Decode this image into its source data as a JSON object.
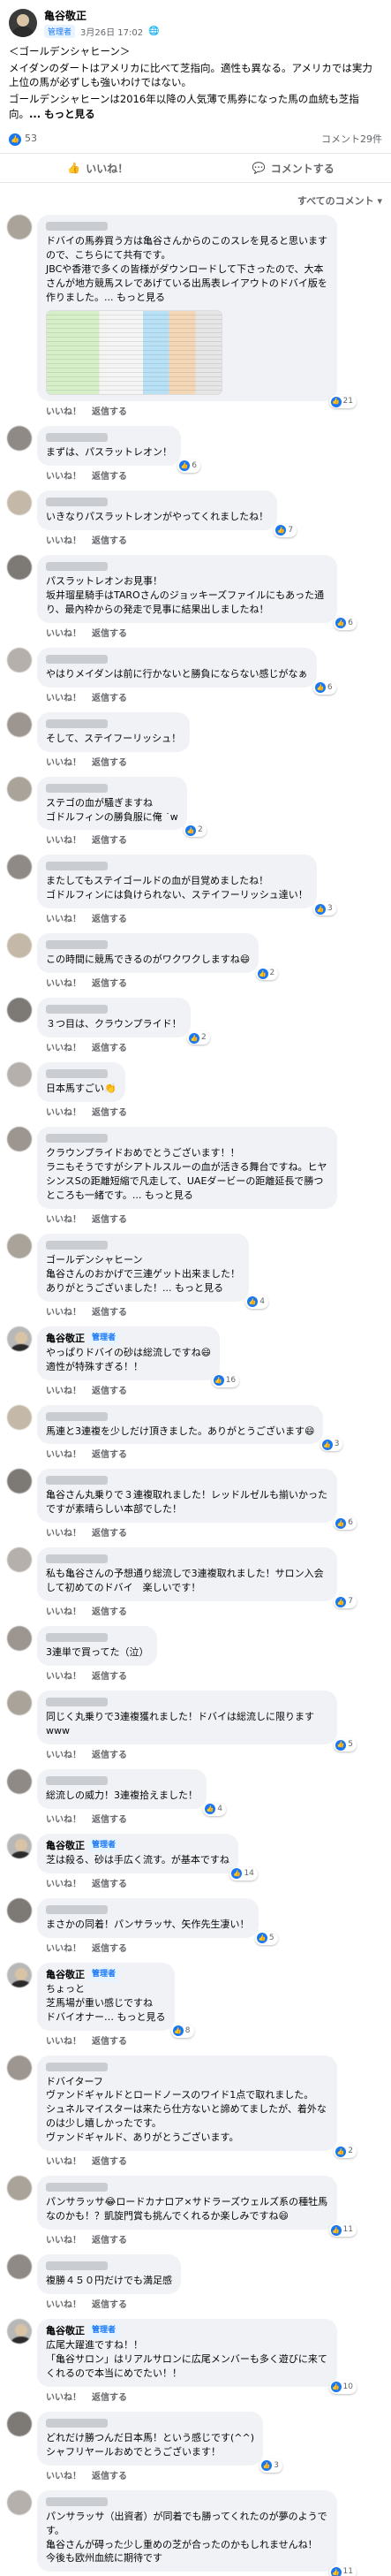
{
  "post": {
    "author": "亀谷敬正",
    "badge": "管理者",
    "date": "3月26日 17:02",
    "lines": [
      "＜ゴールデンシャヒーン＞",
      "メイダンのダートはアメリカに比べて芝指向。適性も異なる。アメリカでは実力上位の馬が必ずしも強いわけではない。",
      "ゴールデンシャヒーンは2016年以降の人気薄で馬券になった馬の血統も芝指向。"
    ],
    "more": "... もっと見る",
    "reactions": "53",
    "comment_count": "コメント29件",
    "like_label": "いいね！",
    "comment_label": "コメントする",
    "sort_label": "すべてのコメント ▾"
  },
  "comments": [
    {
      "name": "",
      "admin": false,
      "text": "ドバイの馬券買う方は亀谷さんからのこのスレを見ると思いますので、こちらにて共有です。\nJBCや香港で多くの皆様がダウンロードして下さったので、大本さんが地方競馬スレであげている出馬表レイアウトのドバイ版を作りました。... もっと見る",
      "time": "",
      "likes": "21",
      "image": true
    },
    {
      "name": "",
      "admin": false,
      "text": "まずは、パスラットレオン！",
      "time": "",
      "likes": "6"
    },
    {
      "name": "",
      "admin": false,
      "text": "いきなりパスラットレオンがやってくれましたね！",
      "time": "",
      "likes": "7"
    },
    {
      "name": "",
      "admin": false,
      "text": "パスラットレオンお見事！\n坂井瑠星騎手はTAROさんのジョッキーズファイルにもあった通り、最內枠からの発走で見事に結果出しましたね！",
      "time": "",
      "likes": "6"
    },
    {
      "name": "",
      "admin": false,
      "text": "やはりメイダンは前に行かないと勝負にならない感じがなぁ",
      "time": "",
      "likes": "6"
    },
    {
      "name": "",
      "admin": false,
      "text": "そして、ステイフーリッシュ！",
      "time": "",
      "likes": ""
    },
    {
      "name": "",
      "admin": false,
      "text": "ステゴの血が騒ぎますね\nゴドルフィンの勝負服に俺 ˙w",
      "time": "",
      "likes": "2"
    },
    {
      "name": "",
      "admin": false,
      "text": "またしてもステイゴールドの血が目覚めましたね！\nゴドルフィンには負けられない、ステイフーリッシュ達い！",
      "time": "",
      "likes": "3"
    },
    {
      "name": "",
      "admin": false,
      "text": "この時間に競馬できるのがワクワクしますね😄",
      "time": "",
      "likes": "2"
    },
    {
      "name": "",
      "admin": false,
      "text": "３つ目は、クラウンプライド！",
      "time": "",
      "likes": "2"
    },
    {
      "name": "",
      "admin": false,
      "text": "日本馬すごい👏",
      "time": "",
      "likes": ""
    },
    {
      "name": "",
      "admin": false,
      "text": "クラウンプライドおめでとうございます！！\nラニもそうですがシアトルスルーの血が活きる舞台ですね。ヒヤシンスSの距離短縮で凡走して、UAEダービーの距離延長で勝つところも一緒です。... もっと見る",
      "time": "",
      "likes": ""
    },
    {
      "name": "",
      "admin": false,
      "text": "ゴールデンシャヒーン\n亀谷さんのおかげで三連ゲット出来ました！\nありがとうございました！... もっと見る",
      "time": "",
      "likes": "4"
    },
    {
      "name": "亀谷敬正",
      "admin": true,
      "text": "やっぱりドバイの砂は総流しですね😄\n適性が特殊すぎる！！",
      "time": "",
      "likes": "16"
    },
    {
      "name": "",
      "admin": false,
      "text": "馬連と3連複を少しだけ頂きました。ありがとうございます😄",
      "time": "",
      "likes": "3"
    },
    {
      "name": "",
      "admin": false,
      "text": "亀谷さん丸乗りで３連複取れました！レッドルゼルも揃いかったですが素晴らしい本部でした！",
      "time": "",
      "likes": "6"
    },
    {
      "name": "",
      "admin": false,
      "text": "私も亀谷さんの予想通り総流しで3連複取れました！サロン入会して初めてのドバイ　楽しいです！",
      "time": "",
      "likes": "7"
    },
    {
      "name": "",
      "admin": false,
      "text": "3連単で買ってた（泣）",
      "time": "",
      "likes": ""
    },
    {
      "name": "",
      "admin": false,
      "text": "同じく丸乗りで3連複獲れました！ドバイは総流しに限りますwww",
      "time": "",
      "likes": "5"
    },
    {
      "name": "",
      "admin": false,
      "text": "総流しの威力！3連複拾えました！",
      "time": "",
      "likes": "4"
    },
    {
      "name": "亀谷敬正",
      "admin": true,
      "text": "芝は殺る、砂は手広く流す。が基本ですね",
      "time": "",
      "likes": "14"
    },
    {
      "name": "",
      "admin": false,
      "text": "まさかの同着！パンサラッサ、矢作先生凄い！",
      "time": "",
      "likes": "5"
    },
    {
      "name": "亀谷敬正",
      "admin": true,
      "text": "ちょっと\n芝馬場が重い感じですね\nドバイオナー… もっと見る",
      "time": "",
      "likes": "8"
    },
    {
      "name": "",
      "admin": false,
      "text": "ドバイターフ\nヴァンドギャルドとロードノースのワイド1点で取れました。\nシュネルマイスターは来たら仕方ないと諦めてましたが、着外なのは少し嬉しかったです。\nヴァンドギャルド、ありがとうございます。",
      "time": "",
      "likes": "2"
    },
    {
      "name": "",
      "admin": false,
      "text": "パンサラッサ😂ロードカナロア×サドラーズウェルズ系の種牡馬なのかも！？凱旋門賞も挑んでくれるか楽しみですね😄",
      "time": "",
      "likes": "11"
    },
    {
      "name": "",
      "admin": false,
      "text": "複勝４５０円だけでも満足感",
      "time": "",
      "likes": ""
    },
    {
      "name": "亀谷敬正",
      "admin": true,
      "text": "広尾大躍進ですね！！\n「亀谷サロン」はリアルサロンに広尾メンバーも多く遊びに来てくれるので本当にめでたい！！",
      "time": "",
      "likes": "10"
    },
    {
      "name": "",
      "admin": false,
      "text": "どれだけ勝つんだ日本馬！という感じです(^^)\nシャフリヤールおめでとうございます！",
      "time": "",
      "likes": "3"
    },
    {
      "name": "",
      "admin": false,
      "text": "パンサラッサ（出資者）が同着でも勝ってくれたのが夢のようです。\n亀谷さんが碍った少し重めの芝が合ったのかもしれませんね！\n今後も欧州血統に期待です",
      "time": "",
      "likes": "11"
    }
  ],
  "comment_actions": {
    "like": "いいね！",
    "reply": "返信する"
  },
  "colors": {
    "accent": "#1877f2",
    "bubble": "#f0f2f5",
    "muted": "#65676b"
  }
}
